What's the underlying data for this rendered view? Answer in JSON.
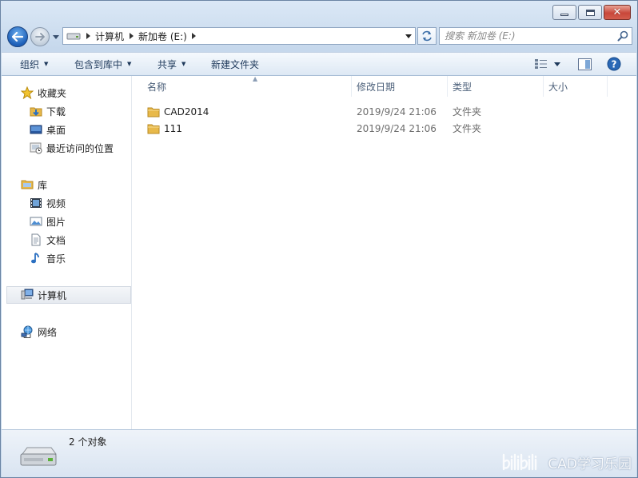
{
  "window": {
    "caption_buttons": [
      "minimize",
      "maximize",
      "close"
    ]
  },
  "address_bar": {
    "crumbs": [
      "计算机",
      "新加卷 (E:)"
    ]
  },
  "search": {
    "placeholder": "搜索 新加卷 (E:)"
  },
  "toolbar": {
    "organize": "组织",
    "include_in_library": "包含到库中",
    "share": "共享",
    "new_folder": "新建文件夹"
  },
  "navigation": {
    "favorites": {
      "label": "收藏夹",
      "items": [
        {
          "label": "下载",
          "icon": "downloads-icon"
        },
        {
          "label": "桌面",
          "icon": "desktop-icon"
        },
        {
          "label": "最近访问的位置",
          "icon": "recent-places-icon"
        }
      ]
    },
    "libraries": {
      "label": "库",
      "items": [
        {
          "label": "视频",
          "icon": "video-icon"
        },
        {
          "label": "图片",
          "icon": "pictures-icon"
        },
        {
          "label": "文档",
          "icon": "documents-icon"
        },
        {
          "label": "音乐",
          "icon": "music-icon"
        }
      ]
    },
    "computer": {
      "label": "计算机",
      "selected": true
    },
    "network": {
      "label": "网络"
    }
  },
  "file_list": {
    "columns": [
      "名称",
      "修改日期",
      "类型",
      "大小"
    ],
    "rows": [
      {
        "name": "CAD2014",
        "modified": "2019/9/24 21:06",
        "type": "文件夹",
        "size": ""
      },
      {
        "name": "111",
        "modified": "2019/9/24 21:06",
        "type": "文件夹",
        "size": ""
      }
    ]
  },
  "status_bar": {
    "item_count": "2 个对象"
  },
  "watermark": {
    "text": "CAD学习乐园"
  },
  "colors": {
    "chrome": "#c6d8ec",
    "close_button": "#c8473a",
    "folder": "#e8b94a",
    "toolbar_text": "#1e395b"
  }
}
